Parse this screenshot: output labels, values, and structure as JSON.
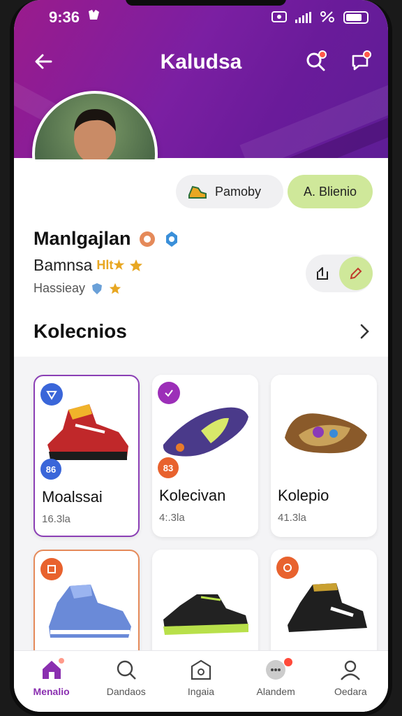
{
  "status_bar": {
    "time": "9:36"
  },
  "header": {
    "title": "Kaludsa"
  },
  "pills": {
    "primary_label": "Pamoby",
    "secondary_label": "A. Blienio"
  },
  "profile": {
    "name": "Manlgajlan",
    "team": "Bamnsa",
    "team_tag": "Hlt★",
    "position": "Hassieay"
  },
  "section": {
    "title": "Kolecnios"
  },
  "cards": [
    {
      "title": "Moalssai",
      "subtitle": "16.3la",
      "count": "86",
      "badge_color": "#3a66d9",
      "count_color": "#3a66d9"
    },
    {
      "title": "Kolecivan",
      "subtitle": "4:.3la",
      "count": "83",
      "badge_color": "#9c2fb8",
      "count_color": "#e8622e"
    },
    {
      "title": "Kolepio",
      "subtitle": "41.3la",
      "count": "",
      "badge_color": "",
      "count_color": ""
    },
    {
      "title": "",
      "subtitle": "",
      "count": "",
      "badge_color": "#e8622e",
      "count_color": ""
    },
    {
      "title": "",
      "subtitle": "",
      "count": "",
      "badge_color": "",
      "count_color": ""
    },
    {
      "title": "",
      "subtitle": "",
      "count": "",
      "badge_color": "#e8622e",
      "count_color": ""
    }
  ],
  "bottom_nav": [
    {
      "label": "Menalio",
      "icon": "home-icon",
      "active": true
    },
    {
      "label": "Dandaos",
      "icon": "search-icon",
      "active": false
    },
    {
      "label": "Ingaia",
      "icon": "box-icon",
      "active": false
    },
    {
      "label": "Alandem",
      "icon": "chat-icon",
      "active": false
    },
    {
      "label": "Oedara",
      "icon": "user-icon",
      "active": false
    }
  ],
  "colors": {
    "brand": "#7b1fa2",
    "accent_green": "#cfe89a",
    "notification": "#ff5a4a"
  }
}
